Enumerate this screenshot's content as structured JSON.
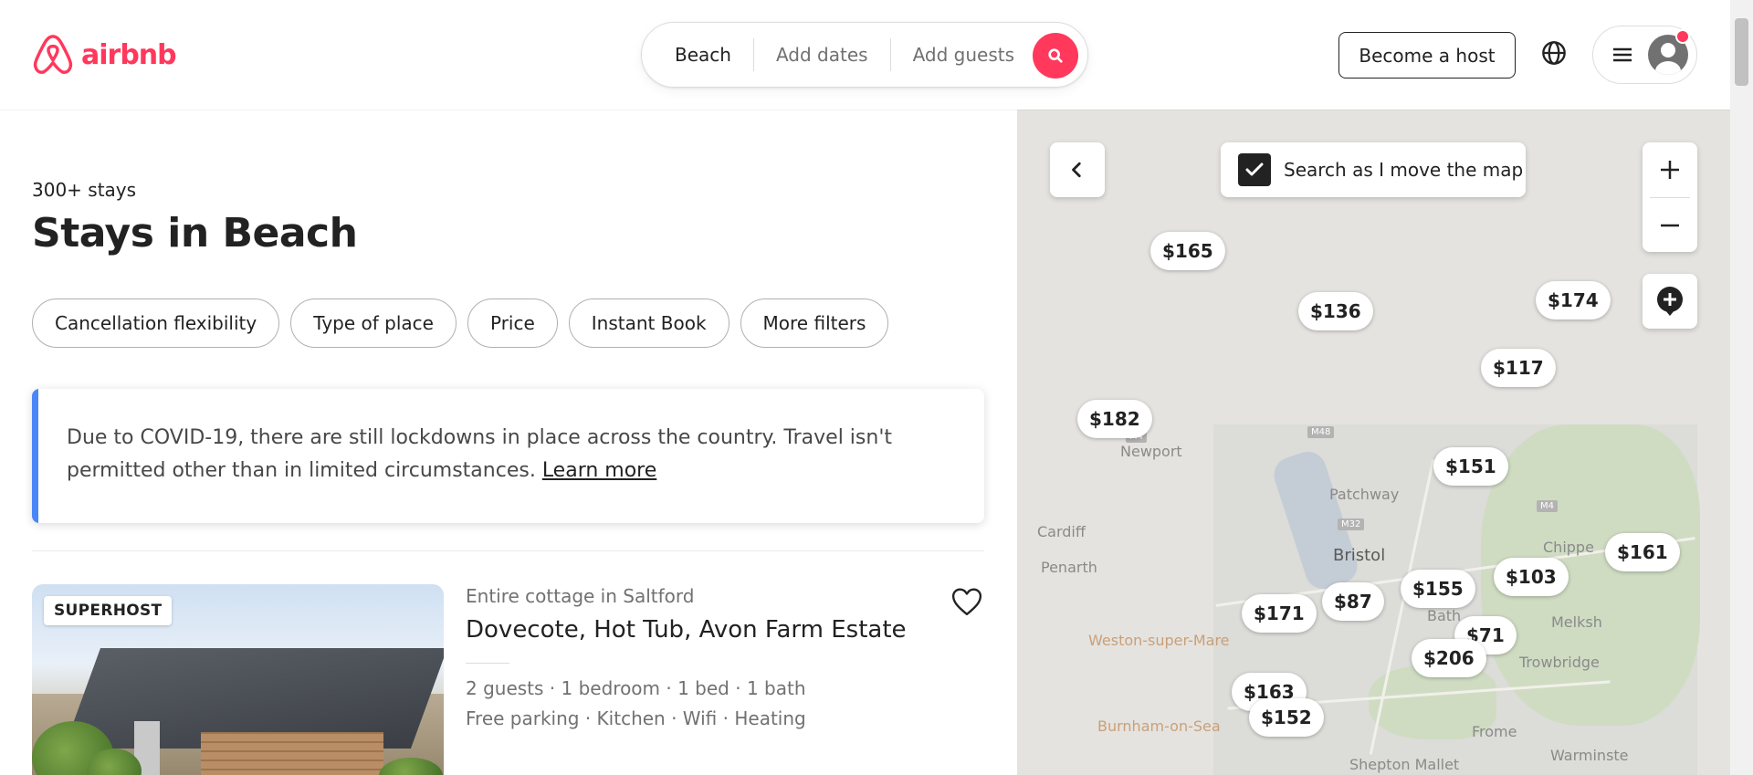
{
  "brand": {
    "name": "airbnb",
    "color": "#ff385c",
    "icon": "airbnb-logo-icon"
  },
  "search": {
    "location": "Beach",
    "dates_placeholder": "Add dates",
    "guests_placeholder": "Add guests",
    "button_icon": "search-icon"
  },
  "header": {
    "become_host": "Become a host",
    "globe_icon": "globe-icon",
    "menu_icon": "hamburger-icon",
    "avatar_icon": "user-avatar-icon"
  },
  "results": {
    "count": "300+ stays",
    "heading": "Stays in Beach"
  },
  "filters": [
    "Cancellation flexibility",
    "Type of place",
    "Price",
    "Instant Book",
    "More filters"
  ],
  "notice": {
    "text": "Due to COVID-19, there are still lockdowns in place across the country. Travel isn't permitted other than in limited circumstances.",
    "link": "Learn more",
    "accent": "#4a86f7"
  },
  "listing": {
    "badge": "SUPERHOST",
    "type": "Entire cottage in Saltford",
    "title": "Dovecote, Hot Tub, Avon Farm Estate",
    "details": "2 guests · 1 bedroom · 1 bed · 1 bath",
    "amenities": "Free parking · Kitchen · Wifi · Heating"
  },
  "map": {
    "search_toggle": "Search as I move the map",
    "search_toggle_checked": true,
    "places": [
      "Newport",
      "Patchway",
      "Cardiff",
      "Penarth",
      "Bristol",
      "Chippe",
      "Bath",
      "Melksh",
      "Weston-super-Mare",
      "Trowbridge",
      "Burnham-on-Sea",
      "Frome",
      "Warminste",
      "Shepton Mallet"
    ],
    "road_shields": [
      "M48",
      "M4",
      "M32",
      "M4"
    ],
    "prices": [
      "$165",
      "$136",
      "$174",
      "$117",
      "$182",
      "$151",
      "$161",
      "$155",
      "$103",
      "$171",
      "$87",
      "$71",
      "$206",
      "$163",
      "$152"
    ]
  }
}
